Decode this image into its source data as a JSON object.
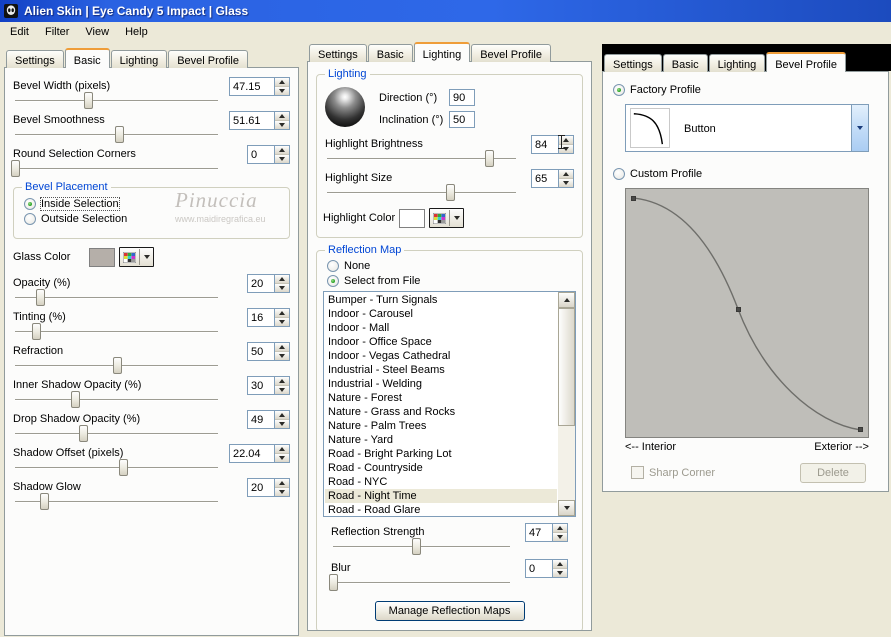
{
  "window": {
    "title": "Alien Skin | Eye Candy 5 Impact | Glass",
    "menu": [
      "Edit",
      "Filter",
      "View",
      "Help"
    ]
  },
  "tab_labels": [
    "Settings",
    "Basic",
    "Lighting",
    "Bevel Profile"
  ],
  "colors": {
    "group_title_blue": "#0046d5",
    "glass_swatch": "#b5afa9",
    "highlight_swatch": "#ffffff",
    "list_selection_bg": "#ece9d8"
  },
  "panels": {
    "left": {
      "active_tab": "Basic",
      "sliders_top": [
        {
          "label": "Bevel Width (pixels)",
          "value": "47.15",
          "thumb": "36%"
        },
        {
          "label": "Bevel Smoothness",
          "value": "51.61",
          "thumb": "51%"
        },
        {
          "label": "Round Selection Corners",
          "value": "0",
          "thumb": "1%"
        }
      ],
      "bevel_placement": {
        "title": "Bevel Placement",
        "inside_label": "Inside Selection",
        "outside_label": "Outside Selection",
        "selected": "Inside Selection"
      },
      "watermark": {
        "name": "Pinuccia",
        "site": "www.maidiregrafica.eu"
      },
      "glass_color_label": "Glass Color",
      "sliders_bottom": [
        {
          "label": "Opacity (%)",
          "value": "20",
          "thumb": "13%"
        },
        {
          "label": "Tinting (%)",
          "value": "16",
          "thumb": "11%"
        },
        {
          "label": "Refraction",
          "value": "50",
          "thumb": "50%"
        },
        {
          "label": "Inner Shadow Opacity (%)",
          "value": "30",
          "thumb": "30%"
        },
        {
          "label": "Drop Shadow Opacity (%)",
          "value": "49",
          "thumb": "34%"
        },
        {
          "label": "Shadow Offset (pixels)",
          "value": "22.04",
          "thumb": "53%"
        },
        {
          "label": "Shadow Glow",
          "value": "20",
          "thumb": "15%"
        }
      ]
    },
    "middle": {
      "active_tab": "Lighting",
      "lighting": {
        "title": "Lighting",
        "direction_label": "Direction (°)",
        "direction_value": "90",
        "inclination_label": "Inclination (°)",
        "inclination_value": "50",
        "brightness": {
          "label": "Highlight Brightness",
          "value": "84",
          "thumb": "85%"
        },
        "size": {
          "label": "Highlight Size",
          "value": "65",
          "thumb": "65%"
        },
        "highlight_color_label": "Highlight Color"
      },
      "reflection": {
        "title": "Reflection Map",
        "none_label": "None",
        "file_label": "Select from File",
        "selected_radio": "Select from File",
        "items": [
          "Bumper - Turn Signals",
          "Indoor - Carousel",
          "Indoor - Mall",
          "Indoor - Office Space",
          "Indoor - Vegas Cathedral",
          "Industrial - Steel Beams",
          "Industrial - Welding",
          "Nature - Forest",
          "Nature - Grass and Rocks",
          "Nature - Palm Trees",
          "Nature - Yard",
          "Road - Bright Parking Lot",
          "Road - Countryside",
          "Road - NYC",
          "Road - Night Time",
          "Road - Road Glare"
        ],
        "selected_index": 14,
        "selected_item": "Road - Night Time",
        "strength": {
          "label": "Reflection Strength",
          "value": "47",
          "thumb": "47%"
        },
        "blur": {
          "label": "Blur",
          "value": "0",
          "thumb": "1%"
        },
        "manage_button": "Manage Reflection Maps"
      }
    },
    "right": {
      "active_tab": "Bevel Profile",
      "factory_label": "Factory Profile",
      "profile_name": "Button",
      "custom_label": "Custom Profile",
      "interior_label": "<-- Interior",
      "exterior_label": "Exterior -->",
      "sharp_corner_label": "Sharp Corner",
      "sharp_corner_disabled": true,
      "delete_label": "Delete",
      "delete_disabled": true
    }
  }
}
